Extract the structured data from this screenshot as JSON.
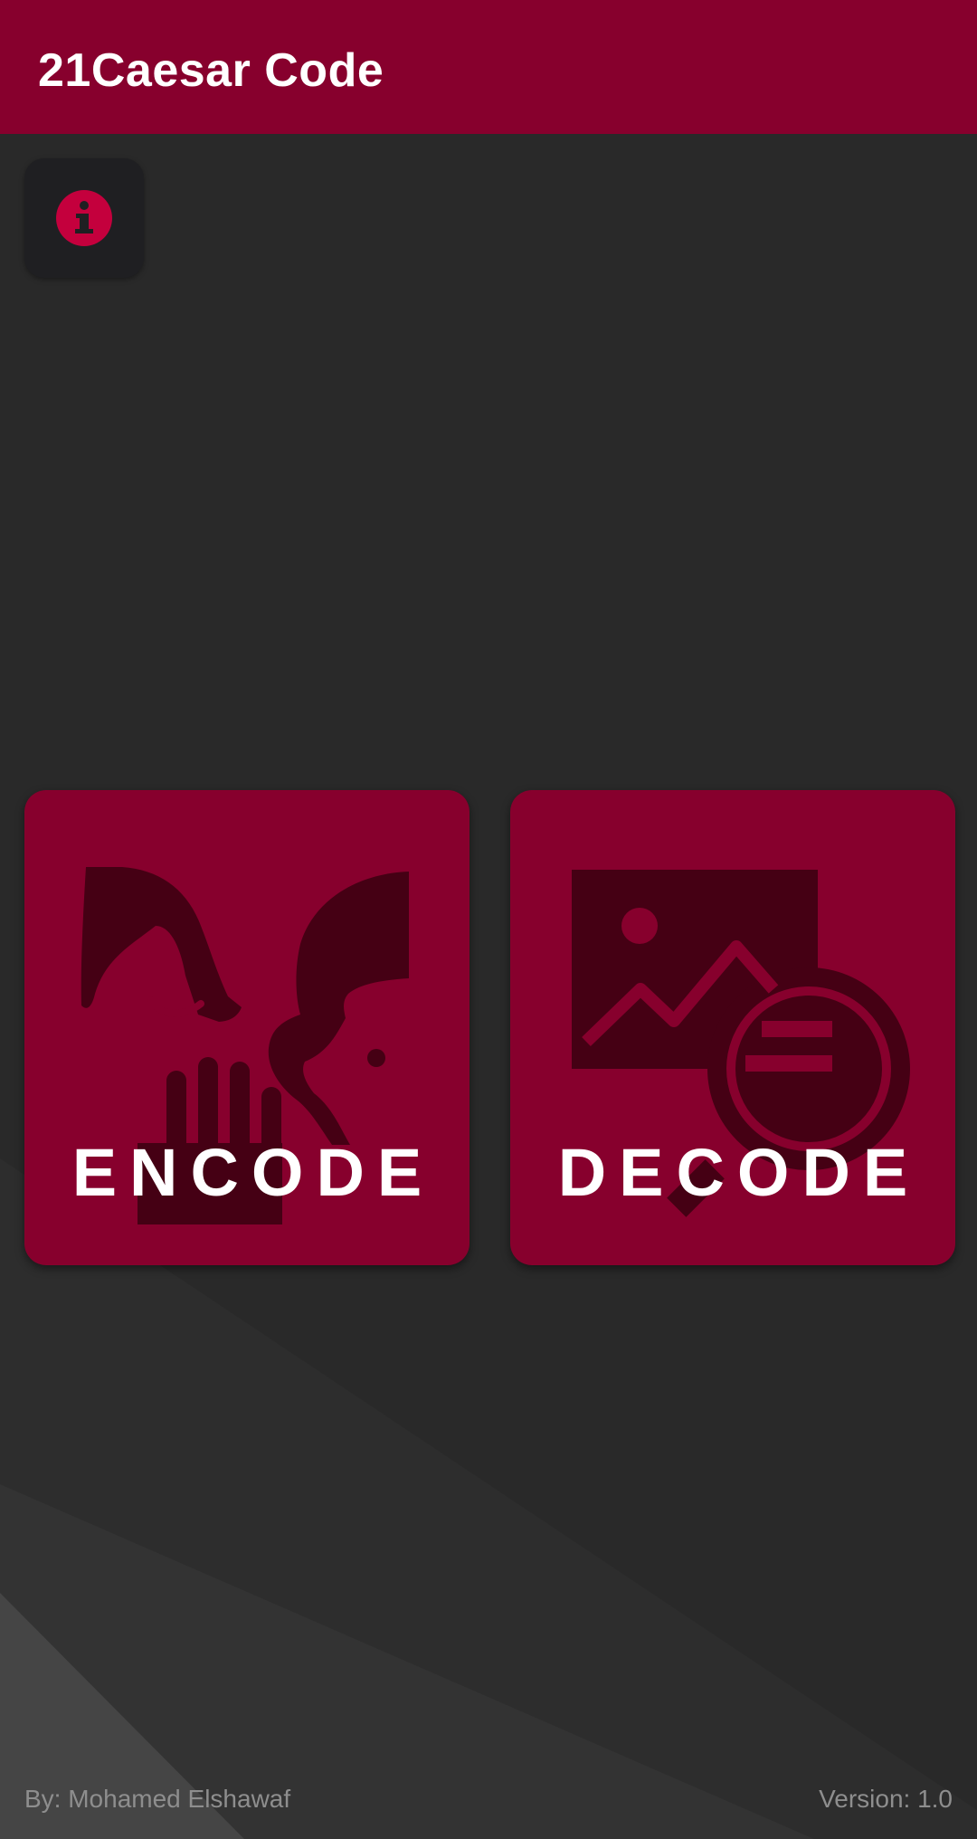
{
  "app_bar": {
    "title": "21Caesar Code"
  },
  "info": {
    "icon": "info-icon"
  },
  "cards": [
    {
      "label": "ENCODE",
      "icon": "whisper-faces-icon"
    },
    {
      "label": "DECODE",
      "icon": "image-search-icon"
    }
  ],
  "footer": {
    "author": "By: Mohamed Elshawaf",
    "version": "Version: 1.0"
  },
  "colors": {
    "primary": "#87002d",
    "accent": "#c4003d",
    "background": "#292929",
    "icon_dark": "#450014"
  }
}
